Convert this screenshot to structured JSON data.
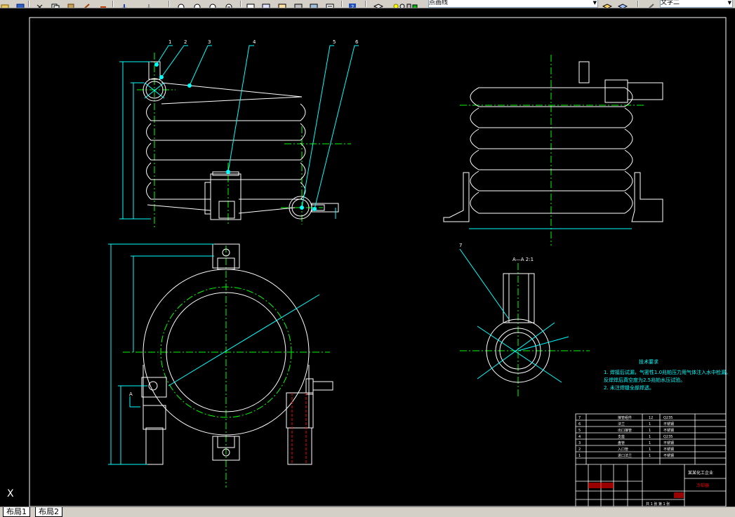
{
  "toolbar": {
    "layer_combo_value": "点画线",
    "text_style_combo_value": "文字二",
    "icons": [
      "open-icon",
      "save-icon",
      "cut-icon",
      "copy-icon",
      "paste-icon",
      "match-properties-icon",
      "undo-icon",
      "redo-icon",
      "pan-icon",
      "zoom-realtime-icon",
      "zoom-window-icon",
      "zoom-previous-icon",
      "properties-icon",
      "design-center-icon",
      "tool-palettes-icon",
      "sheet-set-icon",
      "markup-icon",
      "calculator-icon",
      "help-icon",
      "layer-manager-icon",
      "layer-state-icon",
      "text-style-icon"
    ]
  },
  "drawing": {
    "balloon_numbers": [
      "1",
      "2",
      "3",
      "4",
      "5",
      "6"
    ],
    "section_callout": "7",
    "section_title": "A—A  2:1",
    "section_marker": "A",
    "tech_requirements": {
      "title": "技术要求",
      "items": [
        "1. 焊接后试漏，气密性1.0兆帕压力用气体注入水中检漏。",
        "   反焊焊后真空度为2.5兆帕水压试验。",
        "2. 未注焊缝全部焊透。"
      ]
    },
    "title_block": {
      "company": "某某化工企业",
      "drawing_name": "冷却器",
      "rows": [
        {
          "no": "7",
          "name": "接管组件",
          "qty": "12",
          "material": "Q235"
        },
        {
          "no": "6",
          "name": "法兰",
          "qty": "1",
          "material": "不锈钢"
        },
        {
          "no": "5",
          "name": "出口接管",
          "qty": "1",
          "material": "不锈钢"
        },
        {
          "no": "4",
          "name": "支座",
          "qty": "1",
          "material": "Q235"
        },
        {
          "no": "3",
          "name": "盘管",
          "qty": "1",
          "material": "不锈钢"
        },
        {
          "no": "2",
          "name": "入口管",
          "qty": "1",
          "material": "不锈钢"
        },
        {
          "no": "1",
          "name": "进口法兰",
          "qty": "1",
          "material": "不锈钢"
        }
      ],
      "footer": "共 1 张  第 1 张"
    }
  },
  "layout_tabs": [
    "布局1",
    "布局2"
  ],
  "ucs_label": "X",
  "colors": {
    "background": "#000000",
    "geometry": "#ffffff",
    "centerline": "#00ff00",
    "dimension": "#00ffff",
    "leader": "#00ffff",
    "text": "#00ffff",
    "hidden": "#ff0000",
    "frame": "#ffffff",
    "requirements_text": "#00ffff"
  }
}
